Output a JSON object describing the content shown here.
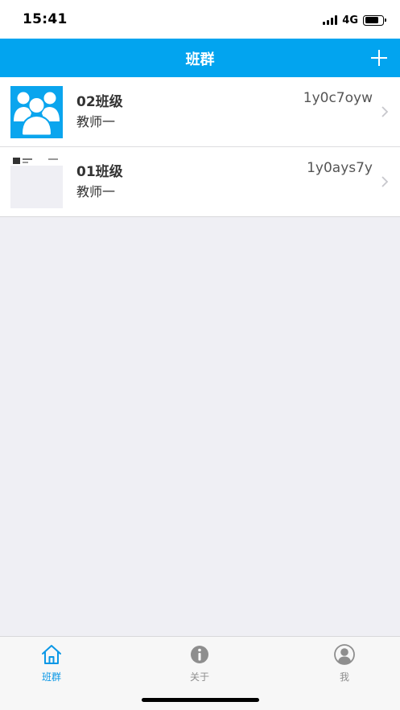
{
  "status_bar": {
    "time": "15:41",
    "network": "4G"
  },
  "nav": {
    "title": "班群",
    "add_icon": "plus-icon"
  },
  "classes": [
    {
      "name": "02班级",
      "teacher": "教师一",
      "code": "1y0c7oyw",
      "avatar": "group-users-icon"
    },
    {
      "name": "01班级",
      "teacher": "教师一",
      "code": "1y0ays7y",
      "avatar": "screenshot-thumbnail"
    }
  ],
  "tabs": [
    {
      "label": "班群",
      "icon": "home-icon",
      "active": true
    },
    {
      "label": "关于",
      "icon": "info-icon",
      "active": false
    },
    {
      "label": "我",
      "icon": "user-icon",
      "active": false
    }
  ],
  "colors": {
    "accent": "#02a4ef",
    "tab_active": "#0a97e6",
    "tab_inactive": "#8e8e8e",
    "background": "#efeff4"
  }
}
